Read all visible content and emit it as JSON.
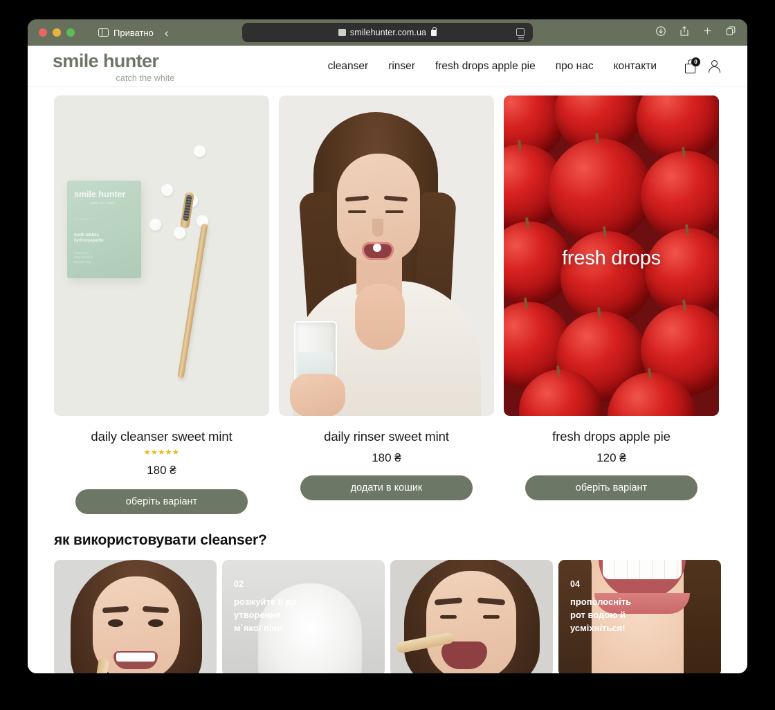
{
  "browser": {
    "private_label": "Приватно",
    "url": "smilehunter.com.ua",
    "icons": {
      "sidebar": "sidebar-icon",
      "back": "‹",
      "download": "download-icon",
      "share": "share-icon",
      "new_tab": "+",
      "tabs": "tabs-icon"
    }
  },
  "site": {
    "logo": "smile hunter",
    "tagline": "catch the white",
    "nav": [
      {
        "label": "cleanser"
      },
      {
        "label": "rinser"
      },
      {
        "label": "fresh drops apple pie"
      },
      {
        "label": "про нас"
      },
      {
        "label": "контакти"
      }
    ],
    "cart_count": "0"
  },
  "products": [
    {
      "title": "daily cleanser sweet mint",
      "price": "180 ₴",
      "rating": "★★★★★",
      "has_rating": true,
      "button": "оберіть варіант",
      "image_alt": "product-box-and-toothbrush",
      "box": {
        "logo": "smile hunter",
        "tagline": "catch the white",
        "dose": "dose 0 1 2 3 4 5",
        "name": "tooth tablets\nhydroxyapatite",
        "sub": "sweet mint\ndaily cleanser\n60 pcs / 30g"
      }
    },
    {
      "title": "daily rinser sweet mint",
      "price": "180 ₴",
      "has_rating": false,
      "button": "додати в кошик",
      "image_alt": "woman-with-glass-of-water"
    },
    {
      "title": "fresh drops apple pie",
      "price": "120 ₴",
      "has_rating": false,
      "button": "оберіть варіант",
      "image_alt": "red-apples",
      "overlay_label": "fresh drops"
    }
  ],
  "howto": {
    "heading": "як використовувати cleanser?",
    "steps": [
      {
        "num": "",
        "text": "",
        "alt": "woman-holding-tablet"
      },
      {
        "num": "02",
        "text": "розжуйте її до\nутворення\nм`якої піни",
        "alt": "white-foam"
      },
      {
        "num": "",
        "text": "",
        "alt": "woman-brushing-teeth"
      },
      {
        "num": "04",
        "text": "прополосніть\nрот водою й\nусміхніться!",
        "alt": "smiling-mouth"
      }
    ]
  },
  "colors": {
    "brand_green": "#6d7765",
    "toolbar_green": "#66705c",
    "star_gold": "#efb70c",
    "text_dark": "#1b1b1b"
  }
}
